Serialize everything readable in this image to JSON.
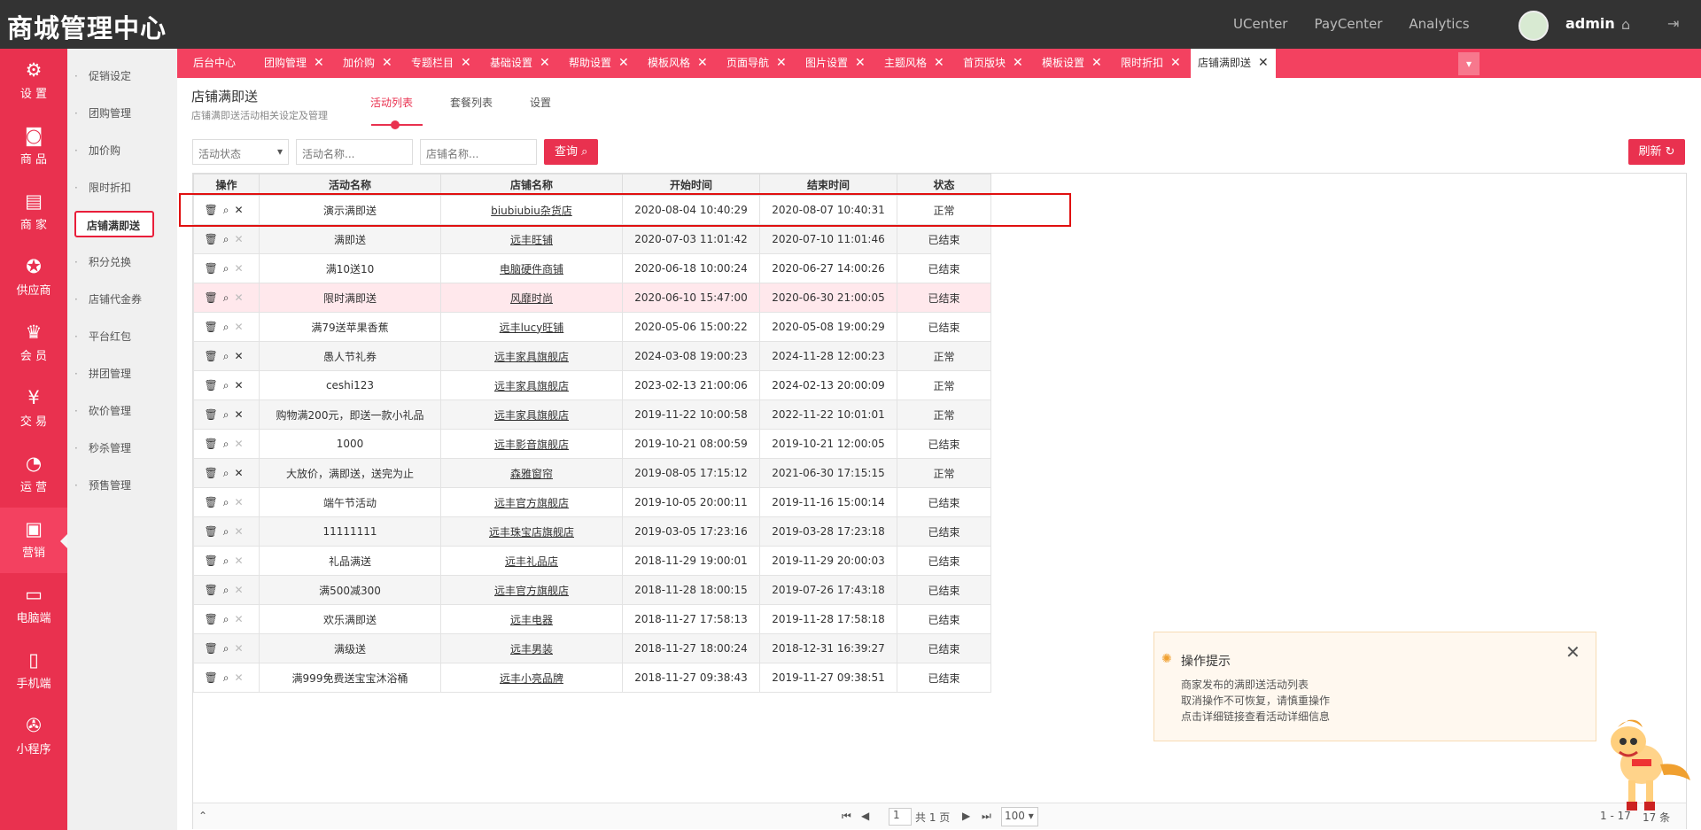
{
  "header": {
    "brand": "商城管理中心",
    "links": [
      "UCenter",
      "PayCenter",
      "Analytics"
    ],
    "user": "admin",
    "home_icon": "home-icon",
    "logout_icon": "logout-icon"
  },
  "leftnav": [
    {
      "label": "设 置",
      "icon": "gear-icon"
    },
    {
      "label": "商 品",
      "icon": "bag-icon"
    },
    {
      "label": "商 家",
      "icon": "store-icon"
    },
    {
      "label": "供应商",
      "icon": "badge-icon"
    },
    {
      "label": "会 员",
      "icon": "crown-icon"
    },
    {
      "label": "交 易",
      "icon": "yen-icon"
    },
    {
      "label": "运 营",
      "icon": "pie-icon"
    },
    {
      "label": "营销",
      "icon": "promo-icon",
      "active": true
    },
    {
      "label": "电脑端",
      "icon": "monitor-icon"
    },
    {
      "label": "手机端",
      "icon": "phone-icon"
    },
    {
      "label": "小程序",
      "icon": "miniapp-icon"
    }
  ],
  "subnav": [
    "促销设定",
    "团购管理",
    "加价购",
    "限时折扣",
    "店铺满即送",
    "积分兑换",
    "店铺代金券",
    "平台红包",
    "拼团管理",
    "砍价管理",
    "秒杀管理",
    "预售管理"
  ],
  "subnav_active": "店铺满即送",
  "tabs": [
    "后台中心",
    "团购管理",
    "加价购",
    "专题栏目",
    "基础设置",
    "帮助设置",
    "模板风格",
    "页面导航",
    "图片设置",
    "主题风格",
    "首页版块",
    "模板设置",
    "限时折扣",
    "店铺满即送"
  ],
  "page": {
    "title": "店铺满即送",
    "subtitle": "店铺满即送活动相关设定及管理",
    "subtabs": [
      "活动列表",
      "套餐列表",
      "设置"
    ]
  },
  "filters": {
    "status_placeholder": "活动状态",
    "name_placeholder": "活动名称...",
    "shop_placeholder": "店铺名称...",
    "query": "查询",
    "refresh": "刷新"
  },
  "columns": [
    "操作",
    "活动名称",
    "店铺名称",
    "开始时间",
    "结束时间",
    "状态"
  ],
  "rows": [
    {
      "name": "演示满即送",
      "shop": "biubiubiu杂货店",
      "start": "2020-08-04 10:40:29",
      "end": "2020-08-07 10:40:31",
      "status": "正常"
    },
    {
      "name": "满即送",
      "shop": "远丰旺铺",
      "start": "2020-07-03 11:01:42",
      "end": "2020-07-10 11:01:46",
      "status": "已结束"
    },
    {
      "name": "满10送10",
      "shop": "电脑硬件商铺",
      "start": "2020-06-18 10:00:24",
      "end": "2020-06-27 14:00:26",
      "status": "已结束"
    },
    {
      "name": "限时满即送",
      "shop": "风靡时尚",
      "start": "2020-06-10 15:47:00",
      "end": "2020-06-30 21:00:05",
      "status": "已结束"
    },
    {
      "name": "满79送苹果香蕉",
      "shop": "远丰lucy旺铺",
      "start": "2020-05-06 15:00:22",
      "end": "2020-05-08 19:00:29",
      "status": "已结束"
    },
    {
      "name": "愚人节礼券",
      "shop": "远丰家具旗舰店",
      "start": "2024-03-08 19:00:23",
      "end": "2024-11-28 12:00:23",
      "status": "正常"
    },
    {
      "name": "ceshi123",
      "shop": "远丰家具旗舰店",
      "start": "2023-02-13 21:00:06",
      "end": "2024-02-13 20:00:09",
      "status": "正常"
    },
    {
      "name": "购物满200元，即送一款小礼品",
      "shop": "远丰家具旗舰店",
      "start": "2019-11-22 10:00:58",
      "end": "2022-11-22 10:01:01",
      "status": "正常"
    },
    {
      "name": "1000",
      "shop": "远丰影音旗舰店",
      "start": "2019-10-21 08:00:59",
      "end": "2019-10-21 12:00:05",
      "status": "已结束"
    },
    {
      "name": "大放价，满即送，送完为止",
      "shop": "森雅窗帘",
      "start": "2019-08-05 17:15:12",
      "end": "2021-06-30 17:15:15",
      "status": "正常"
    },
    {
      "name": "端午节活动",
      "shop": "远丰官方旗舰店",
      "start": "2019-10-05 20:00:11",
      "end": "2019-11-16 15:00:14",
      "status": "已结束"
    },
    {
      "name": "11111111",
      "shop": "远丰珠宝店旗舰店",
      "start": "2019-03-05 17:23:16",
      "end": "2019-03-28 17:23:18",
      "status": "已结束"
    },
    {
      "name": "礼品满送",
      "shop": "远丰礼品店",
      "start": "2018-11-29 19:00:01",
      "end": "2019-11-29 20:00:03",
      "status": "已结束"
    },
    {
      "name": "满500减300",
      "shop": "远丰官方旗舰店",
      "start": "2018-11-28 18:00:15",
      "end": "2019-07-26 17:43:18",
      "status": "已结束"
    },
    {
      "name": "欢乐满即送",
      "shop": "远丰电器",
      "start": "2018-11-27 17:58:13",
      "end": "2019-11-28 17:58:18",
      "status": "已结束"
    },
    {
      "name": "满级送",
      "shop": "远丰男装",
      "start": "2018-11-27 18:00:24",
      "end": "2018-12-31 16:39:27",
      "status": "已结束"
    },
    {
      "name": "满999免费送宝宝沐浴桶",
      "shop": "远丰小亮品牌",
      "start": "2018-11-27 09:38:43",
      "end": "2019-11-27 09:38:51",
      "status": "已结束"
    }
  ],
  "pager": {
    "page": "1",
    "total_pages": "共 1 页",
    "per_page": "100",
    "range": "1 - 17",
    "total": "17 条"
  },
  "tip": {
    "title": "操作提示",
    "lines": [
      "商家发布的满即送活动列表",
      "取消操作不可恢复，请慎重操作",
      "点击详细链接查看活动详细信息"
    ]
  }
}
